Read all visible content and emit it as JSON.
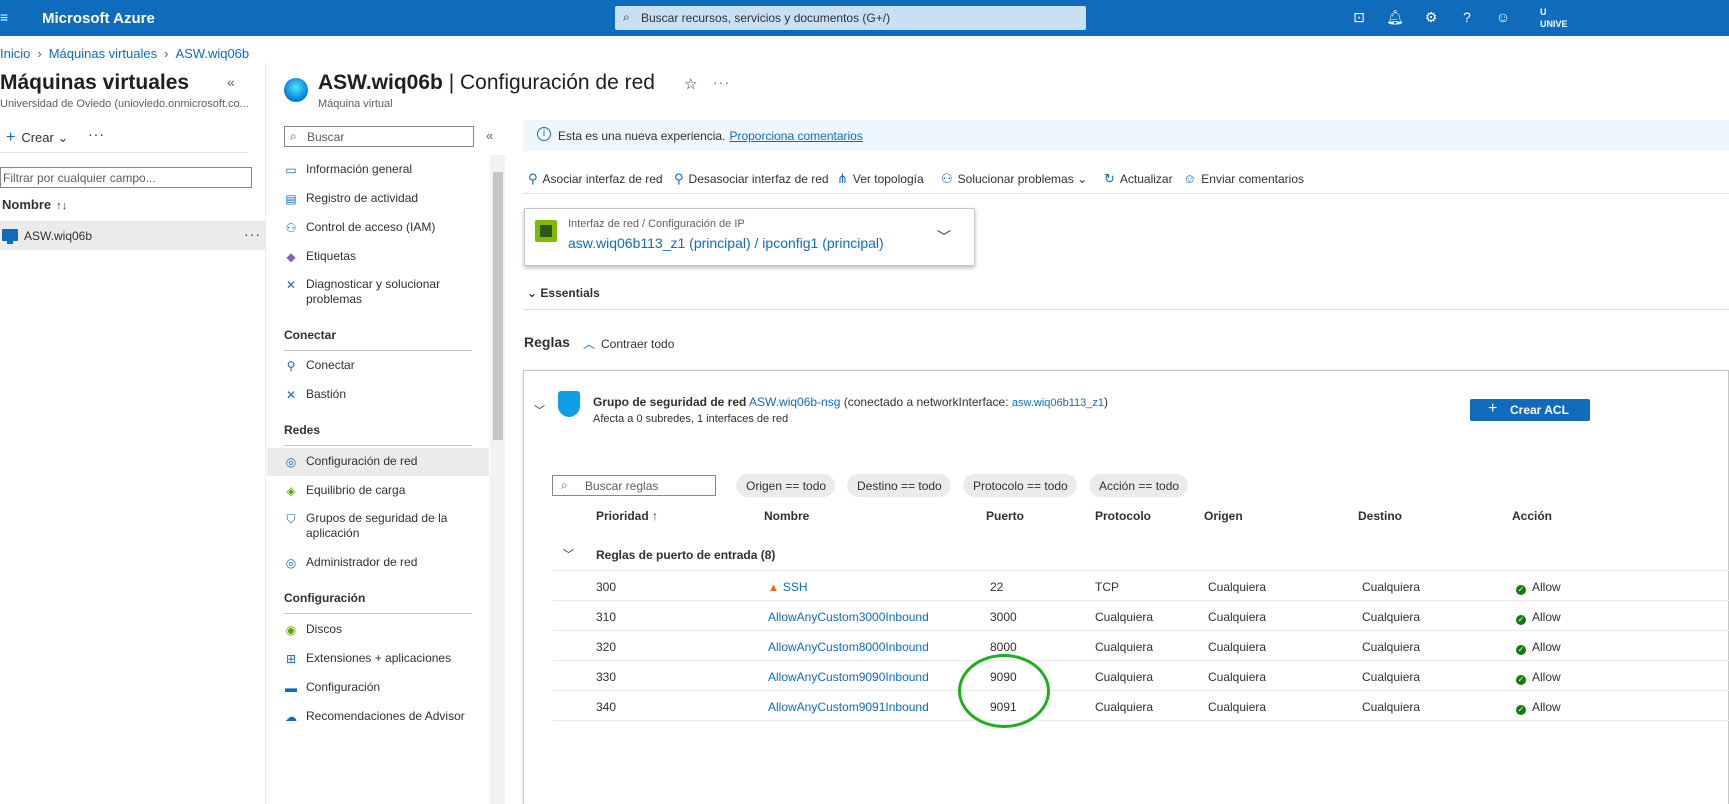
{
  "topbar": {
    "brand": "Microsoft Azure",
    "search_placeholder": "Buscar recursos, servicios y documentos (G+/)",
    "user_label": "U\nUNIVE",
    "icons": [
      "cloud-shell-icon",
      "bell-icon",
      "gear-icon",
      "help-icon",
      "feedback-icon"
    ]
  },
  "breadcrumb": {
    "home": "Inicio",
    "vms": "Máquinas virtuales",
    "vm": "ASW.wiq06b"
  },
  "left_pane": {
    "title": "Máquinas virtuales",
    "subtitle": "Universidad de Oviedo (unioviedo.onmicrosoft.co...",
    "create_label": "Crear",
    "filter_placeholder": "Filtrar por cualquier campo...",
    "column_name": "Nombre",
    "column_sort": "↑↓",
    "row_name": "ASW.wiq06b",
    "row_more": "···"
  },
  "resource": {
    "name": "ASW.wiq06b",
    "section": "| Configuración de red",
    "type": "Máquina virtual"
  },
  "nav": {
    "search_placeholder": "Buscar",
    "items_top": [
      "Información general",
      "Registro de actividad",
      "Control de acceso (IAM)",
      "Etiquetas",
      "Diagnosticar y solucionar problemas"
    ],
    "sec_conectar": "Conectar",
    "items_conectar": [
      "Conectar",
      "Bastión"
    ],
    "sec_redes": "Redes",
    "items_redes": [
      "Configuración de red",
      "Equilibrio de carga",
      "Grupos de seguridad de la aplicación",
      "Administrador de red"
    ],
    "sec_config": "Configuración",
    "items_config": [
      "Discos",
      "Extensiones + aplicaciones",
      "Configuración",
      "Recomendaciones de Advisor"
    ]
  },
  "info_bar": {
    "text": "Esta es una nueva experiencia.",
    "link": "Proporciona comentarios"
  },
  "commands": [
    "Asociar interfaz de red",
    "Desasociar interfaz de red",
    "Ver topología",
    "Solucionar problemas",
    "Actualizar",
    "Enviar comentarios"
  ],
  "nic": {
    "label": "Interfaz de red / Configuración de IP",
    "value": "asw.wiq06b113_z1 (principal) / ipconfig1 (principal)"
  },
  "essentials": "Essentials",
  "rules": {
    "title": "Reglas",
    "collapse": "Contraer todo"
  },
  "nsg": {
    "prefix": "Grupo de seguridad de red",
    "name": "ASW.wiq06b-nsg",
    "conn_open": "(conectado a networkInterface:",
    "iface": "asw.wiq06b113_z1",
    "conn_close": ")",
    "affects": "Afecta a 0 subredes, 1 interfaces de red",
    "create_button": "Crear ACL"
  },
  "filters": {
    "search_placeholder": "Buscar reglas",
    "pills": [
      "Origen == todo",
      "Destino == todo",
      "Protocolo == todo",
      "Acción == todo"
    ]
  },
  "table": {
    "columns": [
      "Prioridad ↑",
      "Nombre",
      "Puerto",
      "Protocolo",
      "Origen",
      "Destino",
      "Acción"
    ],
    "group": "Reglas de puerto de entrada (8)",
    "rows": [
      {
        "priority": "300",
        "name": "SSH",
        "port": "22",
        "protocol": "TCP",
        "source": "Cualquiera",
        "dest": "Cualquiera",
        "action": "Allow",
        "warning": true
      },
      {
        "priority": "310",
        "name": "AllowAnyCustom3000Inbound",
        "port": "3000",
        "protocol": "Cualquiera",
        "source": "Cualquiera",
        "dest": "Cualquiera",
        "action": "Allow",
        "warning": false
      },
      {
        "priority": "320",
        "name": "AllowAnyCustom8000Inbound",
        "port": "8000",
        "protocol": "Cualquiera",
        "source": "Cualquiera",
        "dest": "Cualquiera",
        "action": "Allow",
        "warning": false
      },
      {
        "priority": "330",
        "name": "AllowAnyCustom9090Inbound",
        "port": "9090",
        "protocol": "Cualquiera",
        "source": "Cualquiera",
        "dest": "Cualquiera",
        "action": "Allow",
        "warning": false
      },
      {
        "priority": "340",
        "name": "AllowAnyCustom9091Inbound",
        "port": "9091",
        "protocol": "Cualquiera",
        "source": "Cualquiera",
        "dest": "Cualquiera",
        "action": "Allow",
        "warning": false
      }
    ]
  },
  "colors": {
    "accent": "#0f6cbd",
    "highlight_circle": "#1db01d"
  }
}
